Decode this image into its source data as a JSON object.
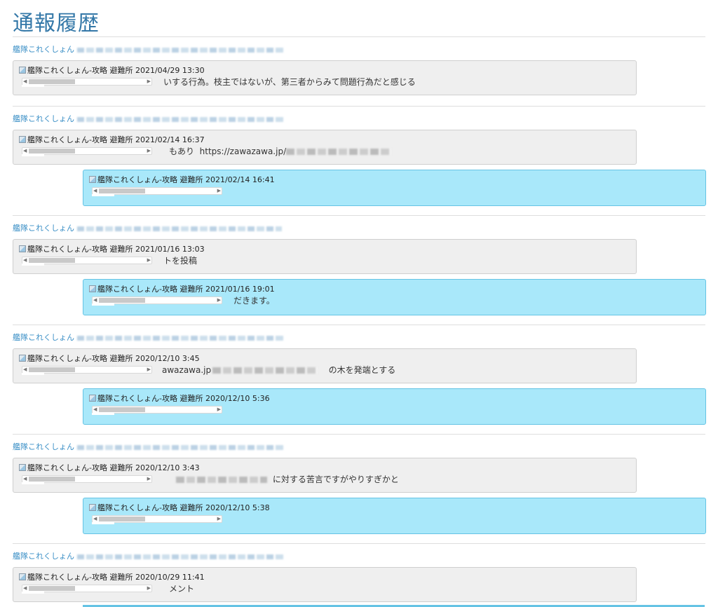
{
  "page_title": "通報履歴",
  "reporter": "艦隊これくしょん",
  "image_alt": "艦隊これくしょん-攻略 避難所",
  "image_timestamps": [
    "2021/04/29 13:30",
    "2021/02/14 16:37",
    "2021/02/14 16:41",
    "2021/01/16 13:03",
    "2021/01/16 19:01",
    "2020/12/10 3:45",
    "2020/12/10 5:36",
    "2020/12/10 3:43",
    "2020/12/10 5:38",
    "2020/10/29 11:41"
  ],
  "comments": {
    "c1": "いする行為。枝主ではないが、第三者からみて問題行為だと感じる",
    "c2_pre": "もあり",
    "c2_url": "https://zawazawa.jp/",
    "c3": "トを投稿",
    "c3_reply": "だきます。",
    "c4_pre": "awazawa.jp",
    "c4_post": "の木を発端とする",
    "c5_post": "に対する苦言ですがやりすぎかと",
    "c6": "メント"
  },
  "icons": {
    "scroll_left": "triangle-left",
    "scroll_right": "triangle-right",
    "broken_image": "broken-image-icon"
  },
  "colors": {
    "title": "#3478a8",
    "link": "#3a8fc6",
    "report_bg": "#efefef",
    "reply_bg": "#a9e8fa",
    "reply_border": "#65c3e4"
  }
}
